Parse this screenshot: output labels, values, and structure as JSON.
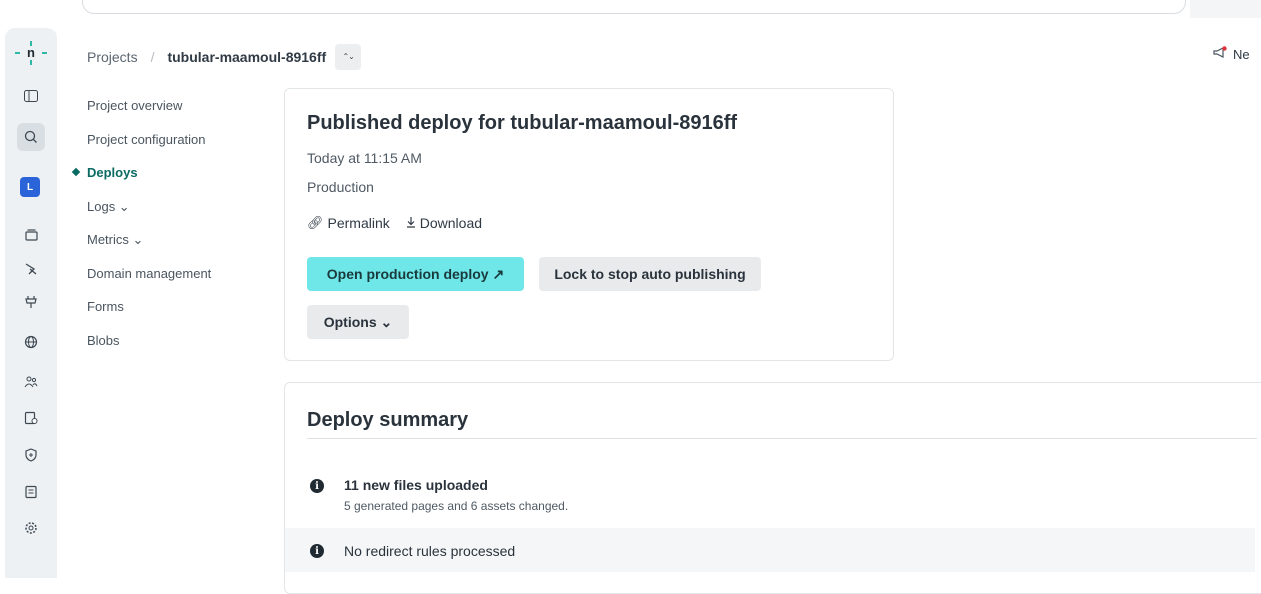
{
  "breadcrumb": {
    "projects_label": "Projects",
    "separator": "/",
    "site_name": "tubular-maamoul-8916ff",
    "switch_icon": "⌃⌄"
  },
  "header": {
    "news_label": "Ne"
  },
  "rail": {
    "avatar_letter": "L"
  },
  "sitenav": {
    "items": [
      {
        "label": "Project overview"
      },
      {
        "label": "Project configuration"
      },
      {
        "label": "Deploys"
      },
      {
        "label": "Logs ⌄"
      },
      {
        "label": "Metrics ⌄"
      },
      {
        "label": "Domain management"
      },
      {
        "label": "Forms"
      },
      {
        "label": "Blobs"
      }
    ]
  },
  "deploy": {
    "title": "Published deploy for tubular-maamoul-8916ff",
    "time": "Today at 11:15 AM",
    "context": "Production",
    "permalink_label": "Permalink",
    "download_label": "Download",
    "open_button": "Open production deploy ↗",
    "lock_button": "Lock to stop auto publishing",
    "options_button": "Options ⌄"
  },
  "summary": {
    "title": "Deploy summary",
    "items": [
      {
        "heading": "11 new files uploaded",
        "detail": "5 generated pages and 6 assets changed."
      },
      {
        "heading": "No redirect rules processed",
        "detail": ""
      }
    ]
  },
  "colors": {
    "primary_button": "#6fe6e8",
    "active_nav": "#0b6b63",
    "avatar": "#2b63d9",
    "rail_bg": "#eef1f3"
  }
}
